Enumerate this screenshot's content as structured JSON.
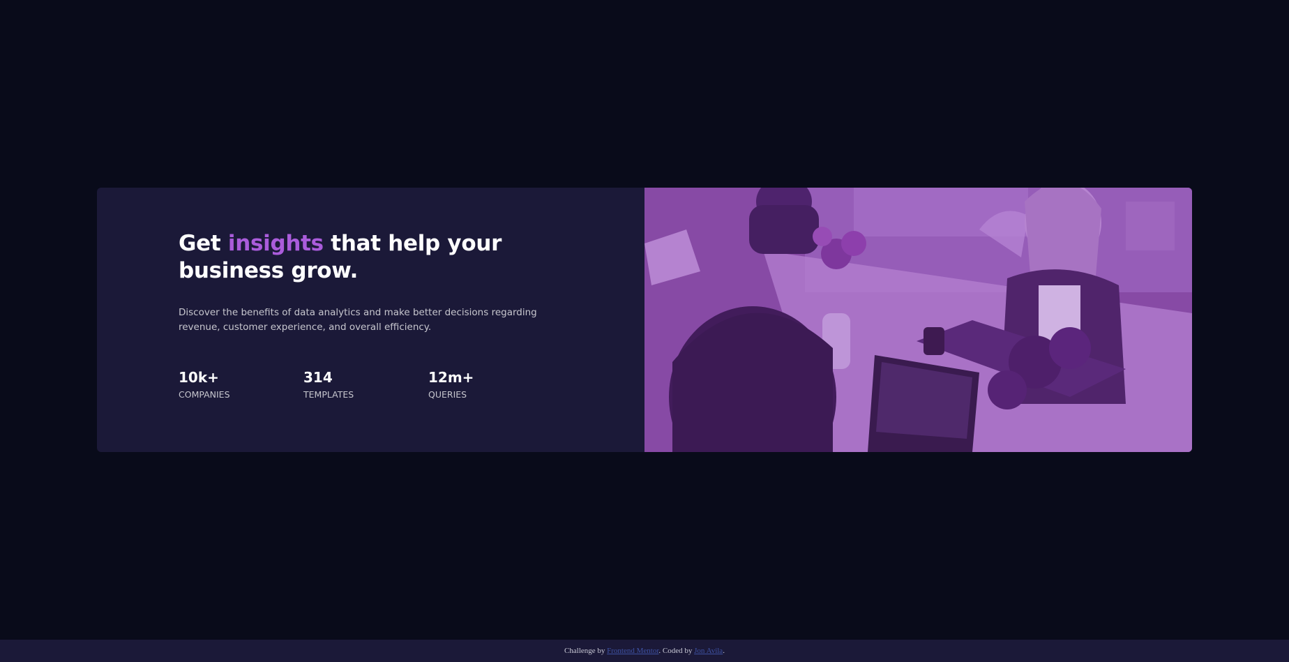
{
  "card": {
    "headline_before": "Get",
    "headline_accent": "insights",
    "headline_after": "that help your business grow.",
    "description": "Discover the benefits of data analytics and make better decisions regarding revenue, customer experience, and overall efficiency.",
    "stats": [
      {
        "value": "10k+",
        "label": "Companies"
      },
      {
        "value": "314",
        "label": "Templates"
      },
      {
        "value": "12m+",
        "label": "Queries"
      }
    ]
  },
  "attribution": {
    "prefix": "Challenge by",
    "link1": "Frontend Mentor",
    "middle": ". Coded by",
    "link2": "Jon Avila",
    "suffix": "."
  },
  "colors": {
    "background": "#090b1a",
    "card": "#1b1938",
    "accent": "#aa5cdb",
    "image_overlay": "#8d4fb6"
  }
}
